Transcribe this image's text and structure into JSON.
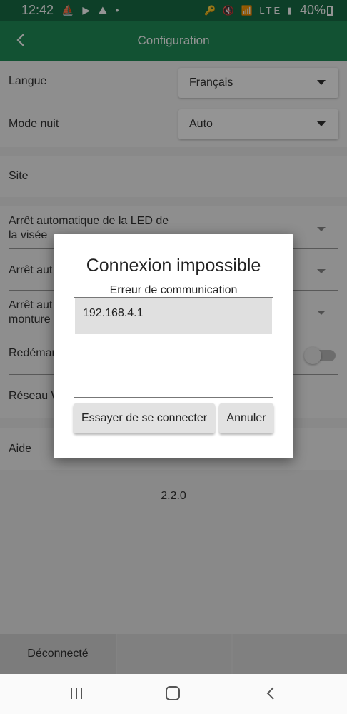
{
  "status_bar": {
    "time": "12:42",
    "left_icons": "⛵ ▶ ⛰ •",
    "right_icons": "🔑 🔇 📶 LTE ▮",
    "battery": "40%"
  },
  "toolbar": {
    "title": "Configuration",
    "back_icon": "back-arrow-icon"
  },
  "settings": {
    "language": {
      "label": "Langue",
      "value": "Français"
    },
    "night_mode": {
      "label": "Mode nuit",
      "value": "Auto"
    },
    "site": {
      "label": "Site"
    },
    "led_auto_off": {
      "label": "Arrêt automatique de la LED de la visée"
    },
    "auto_off_2": {
      "label": "Arrêt aut"
    },
    "auto_off_3": {
      "label": "Arrêt aut monture"
    },
    "restart": {
      "label": "Redémar",
      "enabled": false
    },
    "network": {
      "label": "Réseau W"
    },
    "help": {
      "label": "Aide"
    }
  },
  "version": "2.2.0",
  "bottom_tab": {
    "status": "Déconnecté"
  },
  "dialog": {
    "title": "Connexion impossible",
    "subtitle": "Erreur de communication",
    "hosts": [
      "192.168.4.1"
    ],
    "connect_label": "Essayer de se connecter",
    "cancel_label": "Annuler"
  },
  "colors": {
    "toolbar": "#1f8e58",
    "status_bar": "#176d45"
  }
}
